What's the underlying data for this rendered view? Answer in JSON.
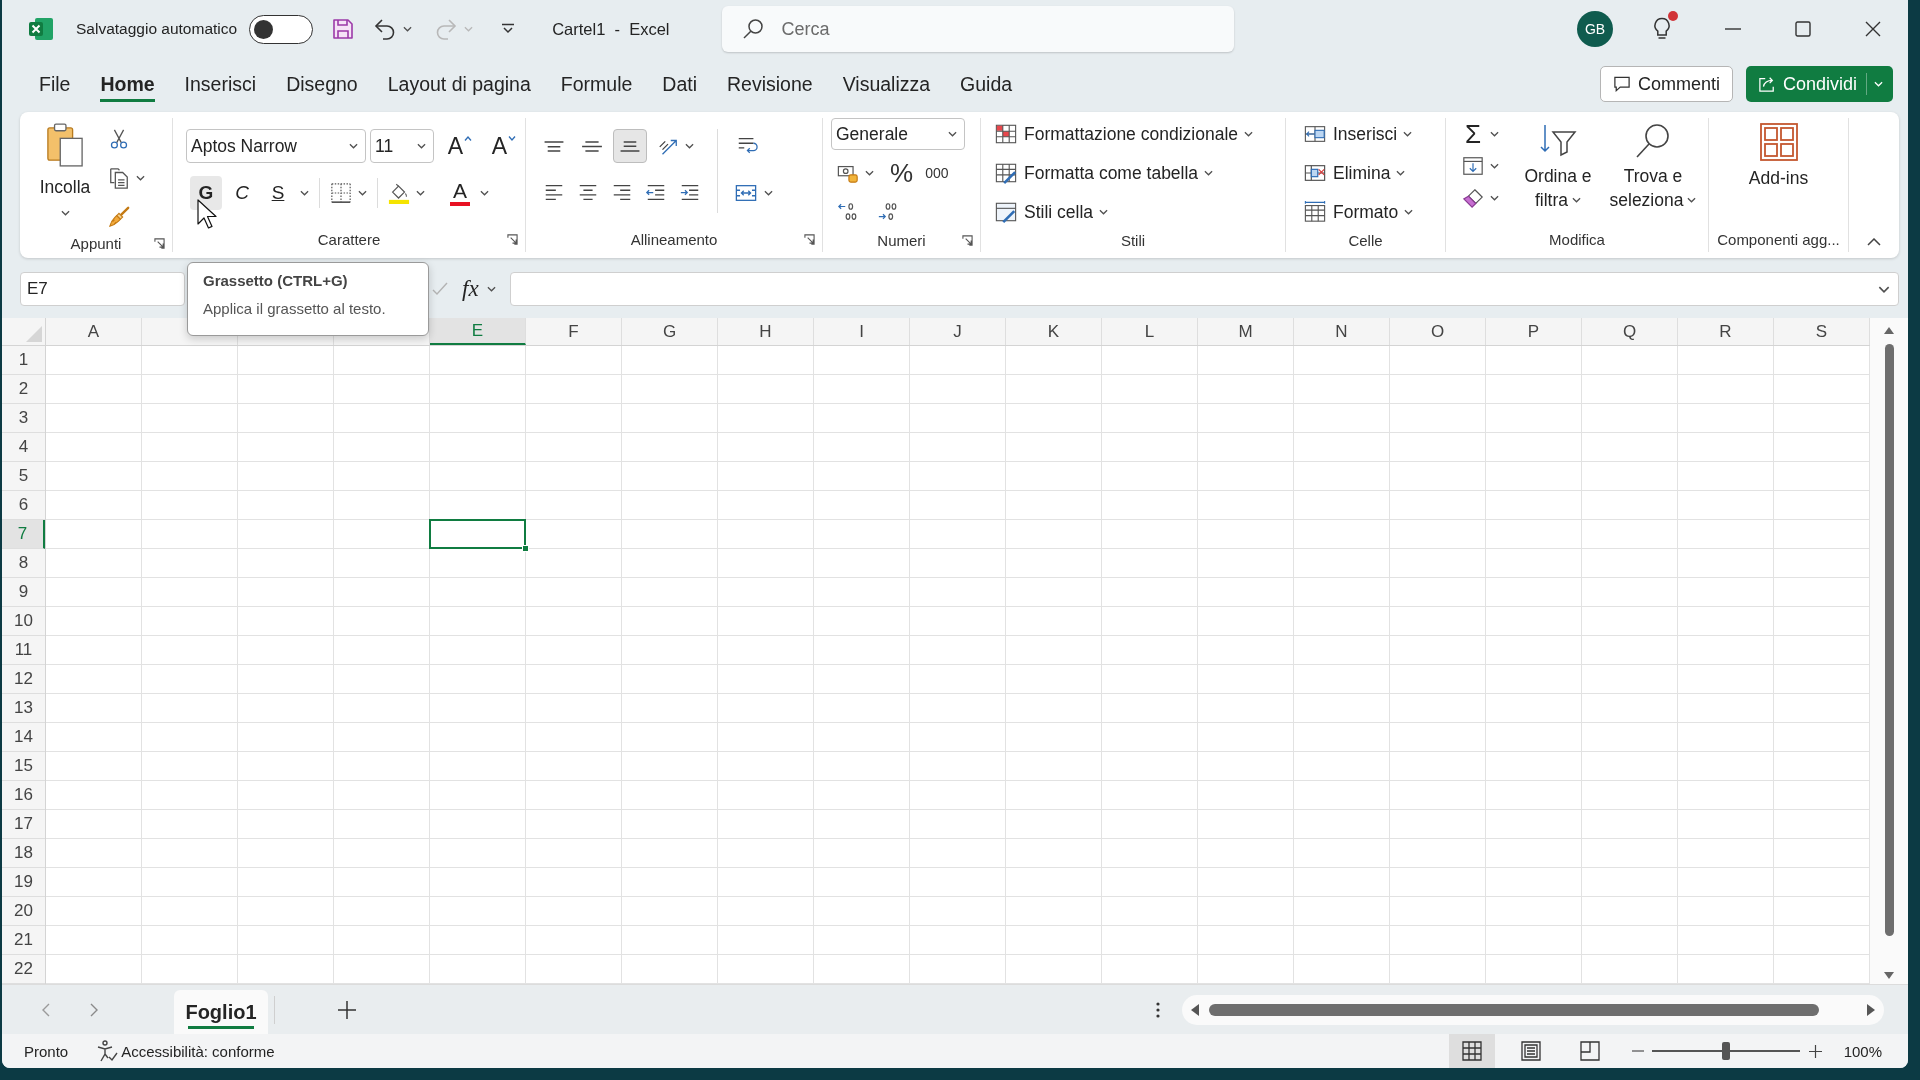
{
  "title_bar": {
    "autosave": {
      "label": "Salvataggio automatico",
      "on": false
    },
    "redo_disabled": true,
    "document_title": "Cartel1  -  Excel",
    "search": {
      "placeholder": "Cerca"
    },
    "account": {
      "initials": "GB"
    },
    "tips_badge": true
  },
  "tabs": [
    {
      "label": "File",
      "selected": false
    },
    {
      "label": "Home",
      "selected": true
    },
    {
      "label": "Inserisci",
      "selected": false
    },
    {
      "label": "Disegno",
      "selected": false
    },
    {
      "label": "Layout di pagina",
      "selected": false
    },
    {
      "label": "Formule",
      "selected": false
    },
    {
      "label": "Dati",
      "selected": false
    },
    {
      "label": "Revisione",
      "selected": false
    },
    {
      "label": "Visualizza",
      "selected": false
    },
    {
      "label": "Guida",
      "selected": false
    }
  ],
  "tab_actions": {
    "comments": "Commenti",
    "share": "Condividi"
  },
  "ribbon": {
    "clipboard": {
      "label": "Appunti",
      "paste": "Incolla"
    },
    "font": {
      "label": "Carattere",
      "font_name": "Aptos Narrow",
      "font_size": "11",
      "grow": "A",
      "shrink": "A",
      "bold": {
        "label": "G",
        "hovered": true
      },
      "italic": "C",
      "underline": "S",
      "font_color": "A"
    },
    "alignment": {
      "label": "Allineamento",
      "vertical": [
        {
          "selected": false
        },
        {
          "selected": false
        },
        {
          "selected": true
        }
      ]
    },
    "number": {
      "label": "Numeri",
      "format": "Generale",
      "percent": "%",
      "thousands": "000"
    },
    "styles": {
      "label": "Stili",
      "items": [
        "Formattazione condizionale",
        "Formatta come tabella",
        "Stili cella"
      ]
    },
    "cells": {
      "label": "Celle",
      "items": [
        "Inserisci",
        "Elimina",
        "Formato"
      ]
    },
    "editing": {
      "label": "Modifica",
      "autosum": "Σ",
      "sort_filter": [
        "Ordina e",
        "filtra"
      ],
      "find_select": [
        "Trova e",
        "seleziona"
      ]
    },
    "addins": {
      "label": "Componenti agg...",
      "button": "Add-ins"
    }
  },
  "tooltip": {
    "title": "Grassetto (CTRL+G)",
    "text": "Applica il grassetto al testo."
  },
  "formula_bar": {
    "name_box": "E7",
    "function_label": "fx"
  },
  "sheet": {
    "columns": [
      {
        "label": "A",
        "selected": false
      },
      {
        "selected": false
      },
      {
        "selected": false
      },
      {
        "selected": false
      },
      {
        "label": "E",
        "selected": true
      },
      {
        "label": "F",
        "selected": false
      },
      {
        "label": "G",
        "selected": false
      },
      {
        "label": "H",
        "selected": false
      },
      {
        "label": "I",
        "selected": false
      },
      {
        "label": "J",
        "selected": false
      },
      {
        "label": "K",
        "selected": false
      },
      {
        "label": "L",
        "selected": false
      },
      {
        "label": "M",
        "selected": false
      },
      {
        "label": "N",
        "selected": false
      },
      {
        "label": "O",
        "selected": false
      },
      {
        "label": "P",
        "selected": false
      },
      {
        "label": "Q",
        "selected": false
      },
      {
        "label": "R",
        "selected": false
      },
      {
        "label": "S",
        "selected": false
      }
    ],
    "rows": [
      {
        "label": "1",
        "selected": false
      },
      {
        "label": "2",
        "selected": false
      },
      {
        "label": "3",
        "selected": false
      },
      {
        "label": "4",
        "selected": false
      },
      {
        "label": "5",
        "selected": false
      },
      {
        "label": "6",
        "selected": false
      },
      {
        "label": "7",
        "selected": true
      },
      {
        "label": "8",
        "selected": false
      },
      {
        "label": "9",
        "selected": false
      },
      {
        "label": "10",
        "selected": false
      },
      {
        "label": "11",
        "selected": false
      },
      {
        "label": "12",
        "selected": false
      },
      {
        "label": "13",
        "selected": false
      },
      {
        "label": "14",
        "selected": false
      },
      {
        "label": "15",
        "selected": false
      },
      {
        "label": "16",
        "selected": false
      },
      {
        "label": "17",
        "selected": false
      },
      {
        "label": "18",
        "selected": false
      },
      {
        "label": "19",
        "selected": false
      },
      {
        "label": "20",
        "selected": false
      },
      {
        "label": "21",
        "selected": false
      },
      {
        "label": "22",
        "selected": false
      }
    ]
  },
  "sheet_tabs": [
    {
      "label": "Foglio1",
      "selected": true
    }
  ],
  "status_bar": {
    "ready": "Pronto",
    "accessibility": "Accessibilità: conforme",
    "views": [
      {
        "selected": true
      },
      {
        "selected": false
      },
      {
        "selected": false
      }
    ],
    "zoom": {
      "level": 0.5,
      "reading": "100%"
    }
  }
}
